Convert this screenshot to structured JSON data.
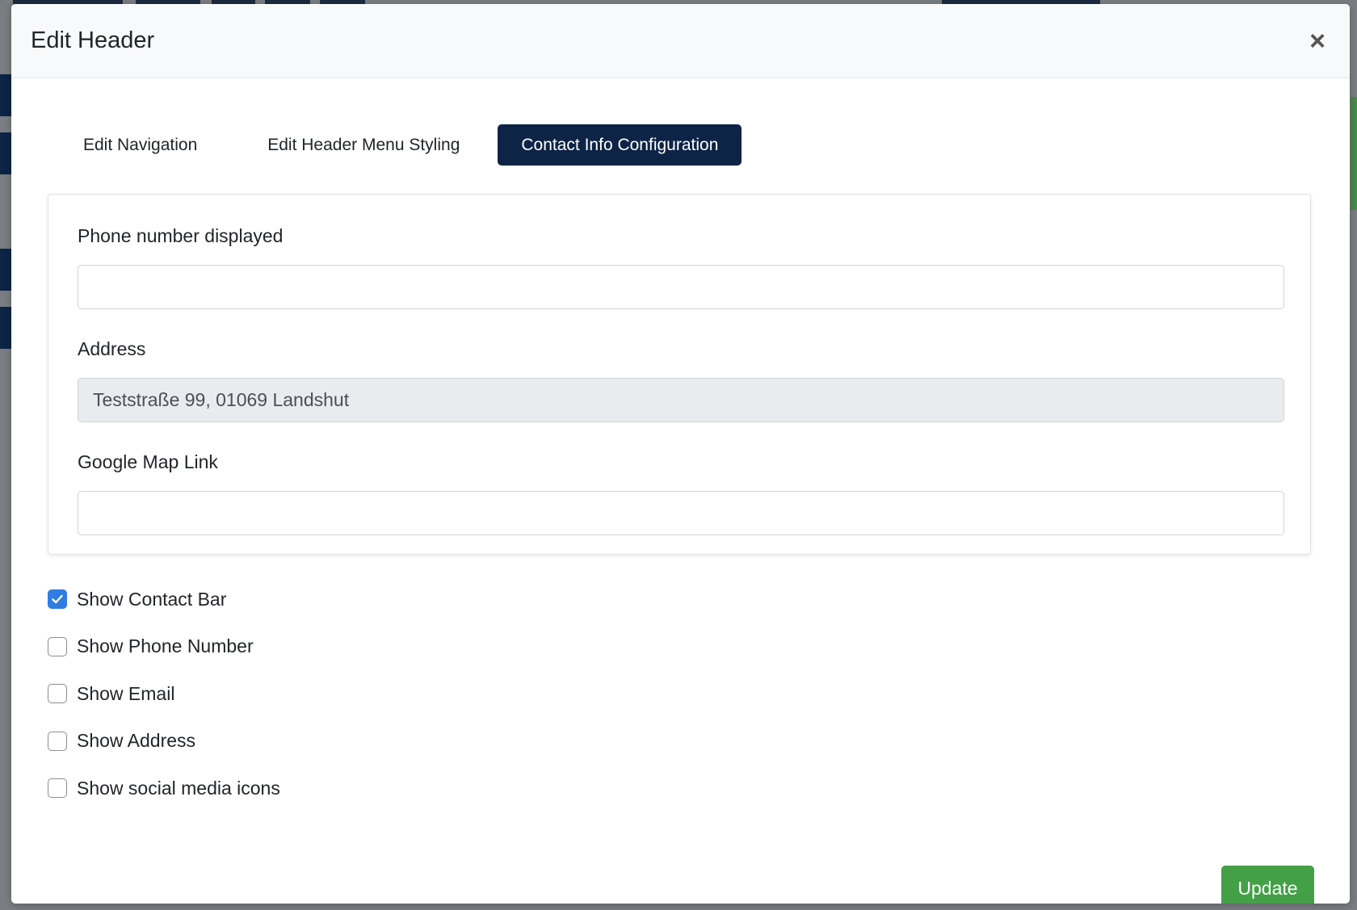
{
  "modal": {
    "title": "Edit Header",
    "close_label": "×"
  },
  "tabs": [
    {
      "label": "Edit Navigation",
      "active": false
    },
    {
      "label": "Edit Header Menu Styling",
      "active": false
    },
    {
      "label": "Contact Info Configuration",
      "active": true
    }
  ],
  "form": {
    "phone": {
      "label": "Phone number displayed",
      "value": ""
    },
    "address": {
      "label": "Address",
      "value": "Teststraße 99, 01069 Landshut"
    },
    "map_link": {
      "label": "Google Map Link",
      "value": ""
    }
  },
  "checkboxes": [
    {
      "label": "Show Contact Bar",
      "checked": true
    },
    {
      "label": "Show Phone Number",
      "checked": false
    },
    {
      "label": "Show Email",
      "checked": false
    },
    {
      "label": "Show Address",
      "checked": false
    },
    {
      "label": "Show social media icons",
      "checked": false
    }
  ],
  "update_label": "Update",
  "colors": {
    "tab_active_bg": "#0d2446",
    "checkbox_checked": "#2f7de1",
    "update_button": "#43a047"
  }
}
